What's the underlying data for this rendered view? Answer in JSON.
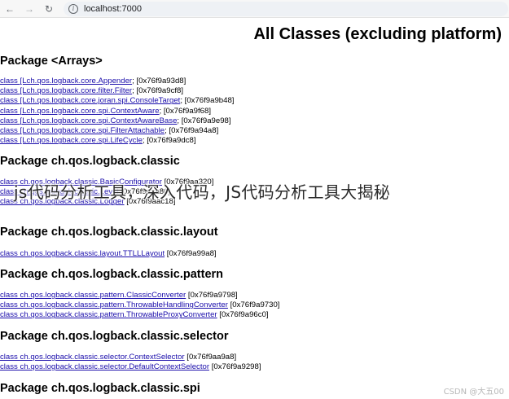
{
  "browser": {
    "back_icon": "back-arrow-icon",
    "forward_icon": "forward-arrow-icon",
    "reload_icon": "reload-icon",
    "url": "localhost:7000"
  },
  "page": {
    "title": "All Classes (excluding platform)",
    "packages": [
      {
        "name": "Package <Arrays>",
        "classes": [
          {
            "prefix": "class ",
            "name": "[Lch.qos.logback.core.Appender",
            "suffix": "; [0x76f9a93d8]"
          },
          {
            "prefix": "class ",
            "name": "[Lch.qos.logback.core.filter.Filter",
            "suffix": "; [0x76f9a9cf8]"
          },
          {
            "prefix": "class ",
            "name": "[Lch.qos.logback.core.joran.spi.ConsoleTarget",
            "suffix": "; [0x76f9a9b48]"
          },
          {
            "prefix": "class ",
            "name": "[Lch.qos.logback.core.spi.ContextAware",
            "suffix": "; [0x76f9a9f68]"
          },
          {
            "prefix": "class ",
            "name": "[Lch.qos.logback.core.spi.ContextAwareBase",
            "suffix": "; [0x76f9a9e98]"
          },
          {
            "prefix": "class ",
            "name": "[Lch.qos.logback.core.spi.FilterAttachable",
            "suffix": "; [0x76f9a94a8]"
          },
          {
            "prefix": "class ",
            "name": "[Lch.qos.logback.core.spi.LifeCycle",
            "suffix": "; [0x76f9a9dc8]"
          }
        ]
      },
      {
        "name": "Package ch.qos.logback.classic",
        "classes": [
          {
            "prefix": "class ",
            "name": "ch.qos.logback.classic.BasicConfigurator",
            "suffix": " [0x76f9aa320]"
          },
          {
            "prefix": "class ",
            "name": "ch.qos.logback.classic.Level",
            "suffix": " [0x76f9aaa80]"
          },
          {
            "prefix": "class ",
            "name": "ch.qos.logback.classic.Logger",
            "suffix": " [0x76f9aac18]"
          }
        ]
      },
      {
        "name": "Package ch.qos.logback.classic.layout",
        "classes": [
          {
            "prefix": "class ",
            "name": "ch.qos.logback.classic.layout.TTLLLayout",
            "suffix": " [0x76f9a99a8]"
          }
        ]
      },
      {
        "name": "Package ch.qos.logback.classic.pattern",
        "classes": [
          {
            "prefix": "class ",
            "name": "ch.qos.logback.classic.pattern.ClassicConverter",
            "suffix": " [0x76f9a9798]"
          },
          {
            "prefix": "class ",
            "name": "ch.qos.logback.classic.pattern.ThrowableHandlingConverter",
            "suffix": " [0x76f9a9730]"
          },
          {
            "prefix": "class ",
            "name": "ch.qos.logback.classic.pattern.ThrowableProxyConverter",
            "suffix": " [0x76f9a96c0]"
          }
        ]
      },
      {
        "name": "Package ch.qos.logback.classic.selector",
        "classes": [
          {
            "prefix": "class ",
            "name": "ch.qos.logback.classic.selector.ContextSelector",
            "suffix": " [0x76f9aa9a8]"
          },
          {
            "prefix": "class ",
            "name": "ch.qos.logback.classic.selector.DefaultContextSelector",
            "suffix": " [0x76f9a9298]"
          }
        ]
      },
      {
        "name": "Package ch.qos.logback.classic.spi",
        "classes": []
      }
    ]
  },
  "overlay_caption": "js代码分析工具，深入代码，JS代码分析工具大揭秘",
  "watermark": "CSDN @大五00"
}
